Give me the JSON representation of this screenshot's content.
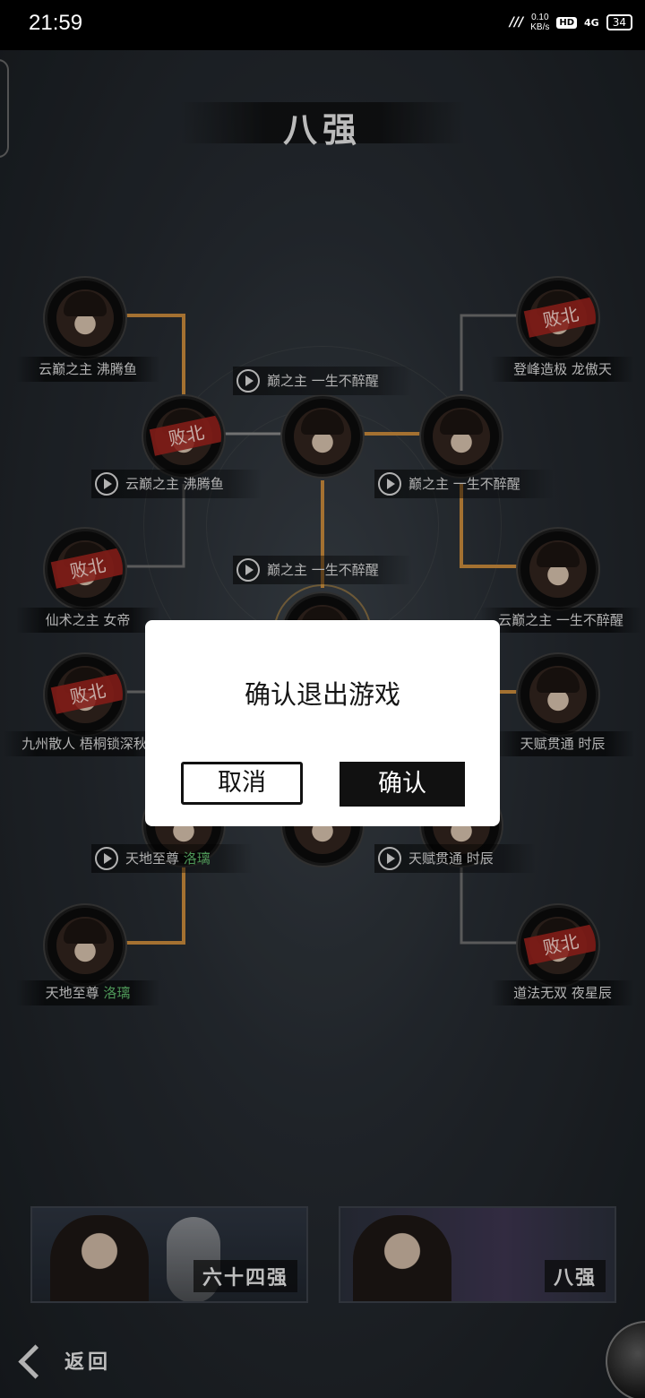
{
  "status_bar": {
    "time": "21:59",
    "network_speed_value": "0.10",
    "network_speed_unit": "KB/s",
    "hd_label": "HD",
    "signal_label": "4G",
    "battery_level": "34"
  },
  "bracket": {
    "round_title": "八强",
    "left_players": [
      {
        "title": "云巅之主",
        "name": "沸腾鱼",
        "defeated": false
      },
      {
        "title": "仙术之主",
        "name": "女帝",
        "defeated": true
      },
      {
        "title": "九州散人",
        "name": "梧桐锁深秋",
        "defeated": true
      },
      {
        "title": "天地至尊",
        "name": "洛璃",
        "defeated": false
      }
    ],
    "right_players": [
      {
        "title": "登峰造极",
        "name": "龙傲天",
        "defeated": true
      },
      {
        "title": "云巅之主",
        "name": "一生不醉醒",
        "defeated": false
      },
      {
        "title": "天赋贯通",
        "name": "时辰",
        "defeated": false
      },
      {
        "title": "道法无双",
        "name": "夜星辰",
        "defeated": true
      }
    ],
    "replays": [
      {
        "title": "巅之主",
        "name": "一生不醉醒"
      },
      {
        "title": "云巅之主",
        "name": "沸腾鱼"
      },
      {
        "title": "巅之主",
        "name": "一生不醉醒"
      },
      {
        "title": "巅之主",
        "name": "一生不醉醒"
      },
      {
        "title": "天地至尊",
        "name": "洛璃"
      },
      {
        "title": "天赋贯通",
        "name": "时辰"
      }
    ],
    "defeat_label": "败北"
  },
  "bottom": {
    "round_cards": [
      {
        "label": "六十四强"
      },
      {
        "label": "八强"
      }
    ],
    "back_label": "返回"
  },
  "dialog": {
    "title": "确认退出游戏",
    "cancel_label": "取消",
    "confirm_label": "确认"
  },
  "colors": {
    "bracket_gold": "#c98a3c",
    "defeat_red": "#a0231e",
    "winner_green": "#5fb86b"
  }
}
